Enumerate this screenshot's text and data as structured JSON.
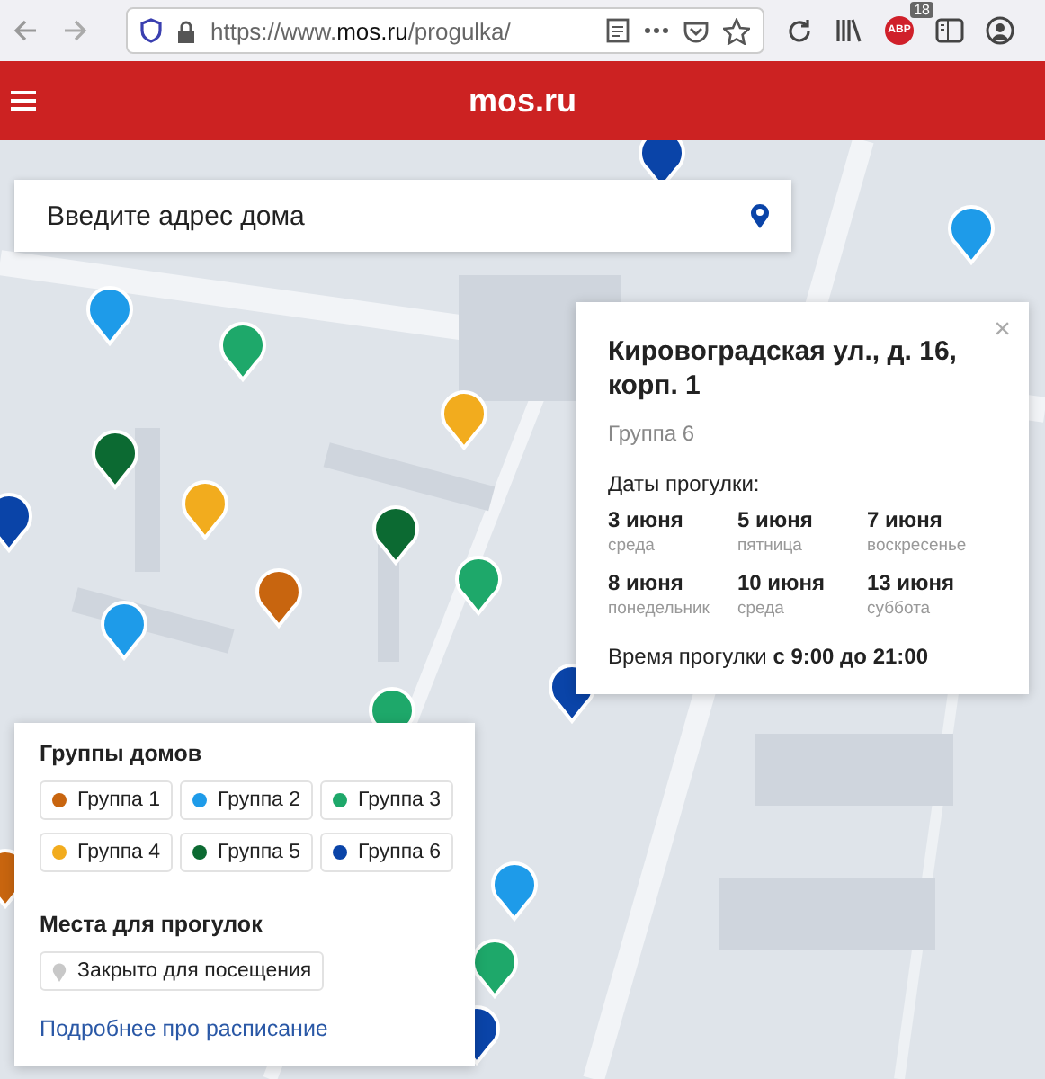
{
  "browser": {
    "url_prefix": "https://www.",
    "url_host": "mos.ru",
    "url_path": "/progulka/",
    "extension_badge": "ABP",
    "extension_count": "18"
  },
  "header": {
    "logo": "mos.ru"
  },
  "search": {
    "placeholder": "Введите адрес дома"
  },
  "popup": {
    "address": "Кировоградская ул., д. 16, корп. 1",
    "group": "Группа 6",
    "dates_label": "Даты прогулки:",
    "dates": [
      {
        "date": "3 июня",
        "weekday": "среда"
      },
      {
        "date": "5 июня",
        "weekday": "пятница"
      },
      {
        "date": "7 июня",
        "weekday": "воскресенье"
      },
      {
        "date": "8 июня",
        "weekday": "понедельник"
      },
      {
        "date": "10 июня",
        "weekday": "среда"
      },
      {
        "date": "13 июня",
        "weekday": "суббота"
      }
    ],
    "time": "Время прогулки **с 9:00 до 21:00**",
    "close": "×"
  },
  "legend": {
    "groups_title": "Группы домов",
    "groups": [
      {
        "label": "Группа 1",
        "color": "#c8650f"
      },
      {
        "label": "Группа 2",
        "color": "#1e9be9"
      },
      {
        "label": "Группа 3",
        "color": "#1ea86a"
      },
      {
        "label": "Группа 4",
        "color": "#f2ac1e"
      },
      {
        "label": "Группа 5",
        "color": "#0c6a32"
      },
      {
        "label": "Группа 6",
        "color": "#0a44a8"
      }
    ],
    "places_title": "Места для прогулок",
    "places": [
      {
        "label": "Закрыто для посещения"
      }
    ],
    "link": "Подробнее про расписание"
  }
}
